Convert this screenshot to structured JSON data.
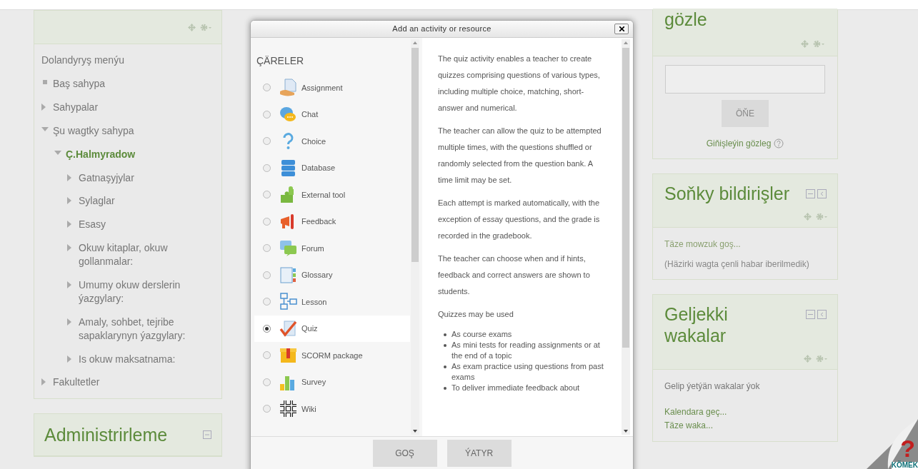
{
  "nav_block": {
    "title": "Dolandyryş menýu",
    "items": [
      {
        "label": "Baş sahypa",
        "kind": "leaf",
        "current": false
      },
      {
        "label": "Sahypalar",
        "kind": "branch",
        "expanded": false,
        "current": false
      },
      {
        "label": "Şu wagtky sahypa",
        "kind": "branch",
        "expanded": true,
        "current": false,
        "children": [
          {
            "label": "Ç.Halmyradow",
            "kind": "branch",
            "expanded": true,
            "current": true,
            "children": [
              {
                "label": "Gatnaşyjylar",
                "kind": "branch",
                "expanded": false,
                "current": false
              },
              {
                "label": "Sylaglar",
                "kind": "branch",
                "expanded": false,
                "current": false
              },
              {
                "label": "Esasy",
                "kind": "branch",
                "expanded": false,
                "current": false
              },
              {
                "label": "Okuw kitaplar, okuw gollanmalar:",
                "kind": "branch",
                "expanded": false,
                "current": false
              },
              {
                "label": "Umumy okuw derslerin ýazgylary:",
                "kind": "branch",
                "expanded": false,
                "current": false
              },
              {
                "label": "Amaly, sohbet, tejribe sapaklarynyn ýazgylary:",
                "kind": "branch",
                "expanded": false,
                "current": false
              },
              {
                "label": "Is okuw maksatnama:",
                "kind": "branch",
                "expanded": false,
                "current": false
              }
            ]
          }
        ]
      },
      {
        "label": "Fakultetler",
        "kind": "branch",
        "expanded": false,
        "current": false
      }
    ]
  },
  "admin_block": {
    "title": "Administrirleme"
  },
  "dialog": {
    "title": "Add an activity or resource",
    "list_heading": "ÇÄRELER",
    "activities": [
      {
        "label": "Assignment",
        "selected": false
      },
      {
        "label": "Chat",
        "selected": false
      },
      {
        "label": "Choice",
        "selected": false
      },
      {
        "label": "Database",
        "selected": false
      },
      {
        "label": "External tool",
        "selected": false
      },
      {
        "label": "Feedback",
        "selected": false
      },
      {
        "label": "Forum",
        "selected": false
      },
      {
        "label": "Glossary",
        "selected": false
      },
      {
        "label": "Lesson",
        "selected": false
      },
      {
        "label": "Quiz",
        "selected": true
      },
      {
        "label": "SCORM package",
        "selected": false
      },
      {
        "label": "Survey",
        "selected": false
      },
      {
        "label": "Wiki",
        "selected": false
      }
    ],
    "description": {
      "paragraphs": [
        "The quiz activity enables a teacher to create quizzes comprising questions of various types, including multiple choice, matching, short-answer and numerical.",
        "The teacher can allow the quiz to be attempted multiple times, with the questions shuffled or randomly selected from the question bank. A time limit may be set.",
        "Each attempt is marked automatically, with the exception of essay questions, and the grade is recorded in the gradebook.",
        "The teacher can choose when and if hints, feedback and correct answers are shown to students.",
        "Quizzes may be used"
      ],
      "bullets": [
        "As course exams",
        "As mini tests for reading assignments or at the end of a topic",
        "As exam practice using questions from past exams",
        "To deliver immediate feedback about"
      ]
    },
    "buttons": [
      "GOŞ",
      "ÝATYR"
    ]
  },
  "search_block": {
    "title": "gözle",
    "button": "ÖŇE",
    "advanced_link": "Giňişleýin gözleg"
  },
  "news_block": {
    "title": "Soňky bildirişler",
    "link": "Täze mowzuk goş...",
    "message": "(Häzirki wagta çenli habar iberilmedik)"
  },
  "events_block": {
    "title": "Geljekki wakalar",
    "message": "Gelip ýetýän wakalar ýok",
    "links": [
      "Kalendara geç...",
      "Täze waka..."
    ]
  },
  "help_corner": {
    "symbol": "?",
    "label": "KÖMEK"
  }
}
